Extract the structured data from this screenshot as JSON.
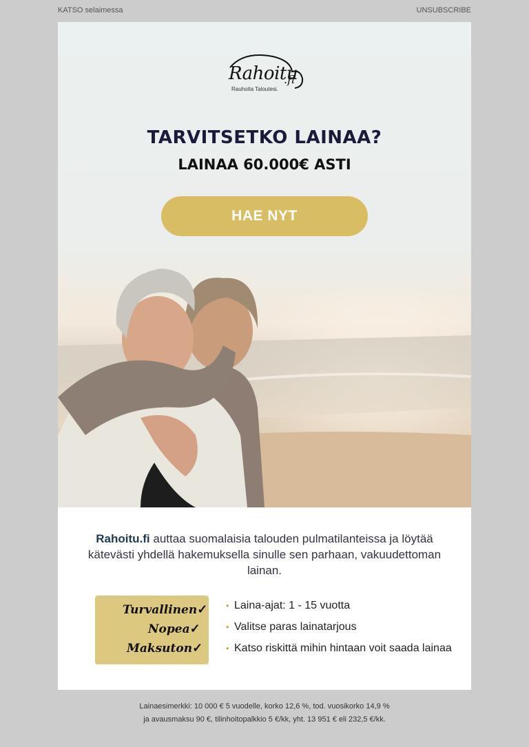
{
  "topbar": {
    "view_in_browser": "KATSO selaimessa",
    "unsubscribe": "UNSUBSCRIBE"
  },
  "logo": {
    "word": "Rahoitu",
    "tld": ".fi",
    "tagline": "Rauhoita Taloutesi."
  },
  "hero": {
    "headline": "TARVITSETKO LAINAA?",
    "subheadline": "LAINAA 60.000€ ASTI",
    "cta_label": "HAE NYT"
  },
  "intro": {
    "brand": "Rahoitu.fi",
    "text": " auttaa suomalaisia talouden pulmatilanteissa ja löytää kätevästi yhdellä hakemuksella sinulle sen parhaan, vakuudettoman lainan."
  },
  "badge": {
    "items": [
      "Turvallinen",
      "Nopea",
      "Maksuton"
    ],
    "check": "✓"
  },
  "features": {
    "bullet": "•",
    "items": [
      "Laina-ajat: 1 - 15 vuotta",
      "Valitse paras lainatarjous",
      "Katso riskittä mihin hintaan voit saada lainaa"
    ]
  },
  "footer": {
    "line1": "Lainaesimerkki: 10 000 € 5 vuodelle, korko 12,6 %, tod. vuosikorko 14,9 %",
    "line2": "ja avausmaksu 90 €, tilinhoitopalkkio 5 €/kk, yht. 13 951 € eli 232,5 €/kk."
  },
  "colors": {
    "page_bg": "#cccccc",
    "hero_bg": "#ebf0f0",
    "cta": "#d8bd63",
    "badge": "#ddc880",
    "headline": "#1a1a3a",
    "brand": "#1e3a52",
    "bullet": "#c9a55a"
  }
}
